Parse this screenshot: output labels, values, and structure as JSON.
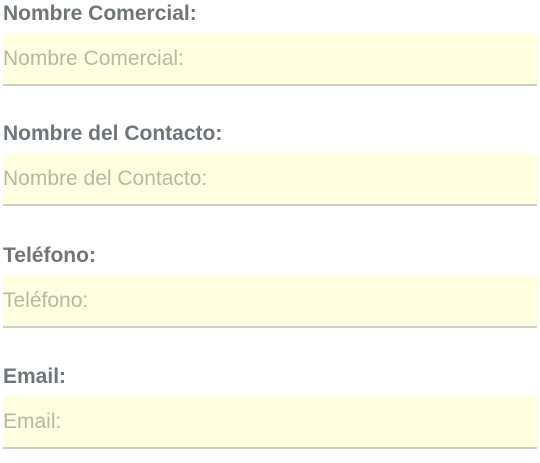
{
  "form": {
    "fields": [
      {
        "label": "Nombre Comercial:",
        "value": "",
        "placeholder": "Nombre Comercial:"
      },
      {
        "label": "Nombre del Contacto:",
        "value": "",
        "placeholder": "Nombre del Contacto:"
      },
      {
        "label": "Teléfono:",
        "value": "",
        "placeholder": "Teléfono:"
      },
      {
        "label": "Email:",
        "value": "",
        "placeholder": "Email:"
      }
    ]
  },
  "colors": {
    "label_text": "#6f7679",
    "input_background": "#ffffe0",
    "placeholder_text": "#b7b8a4",
    "input_underline": "#cfd0c2"
  }
}
